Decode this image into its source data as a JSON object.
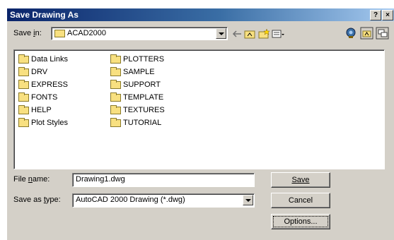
{
  "window": {
    "title": "Save Drawing As",
    "help_label": "?",
    "close_label": "×"
  },
  "save_in": {
    "label_prefix": "Save ",
    "label_accel": "i",
    "label_suffix": "n:",
    "value": "ACAD2000"
  },
  "folders": [
    {
      "name": "Data Links"
    },
    {
      "name": "DRV"
    },
    {
      "name": "EXPRESS"
    },
    {
      "name": "FONTS"
    },
    {
      "name": "HELP"
    },
    {
      "name": "Plot Styles"
    },
    {
      "name": "PLOTTERS"
    },
    {
      "name": "SAMPLE"
    },
    {
      "name": "SUPPORT"
    },
    {
      "name": "TEMPLATE"
    },
    {
      "name": "TEXTURES"
    },
    {
      "name": "TUTORIAL"
    }
  ],
  "file_name": {
    "label_prefix": "File ",
    "label_accel": "n",
    "label_suffix": "ame:",
    "value": "Drawing1.dwg"
  },
  "save_as_type": {
    "label_prefix": "Save as ",
    "label_accel": "t",
    "label_suffix": "ype:",
    "value": "AutoCAD 2000 Drawing (*.dwg)"
  },
  "buttons": {
    "save": "Save",
    "cancel": "Cancel",
    "options": "Options..."
  }
}
